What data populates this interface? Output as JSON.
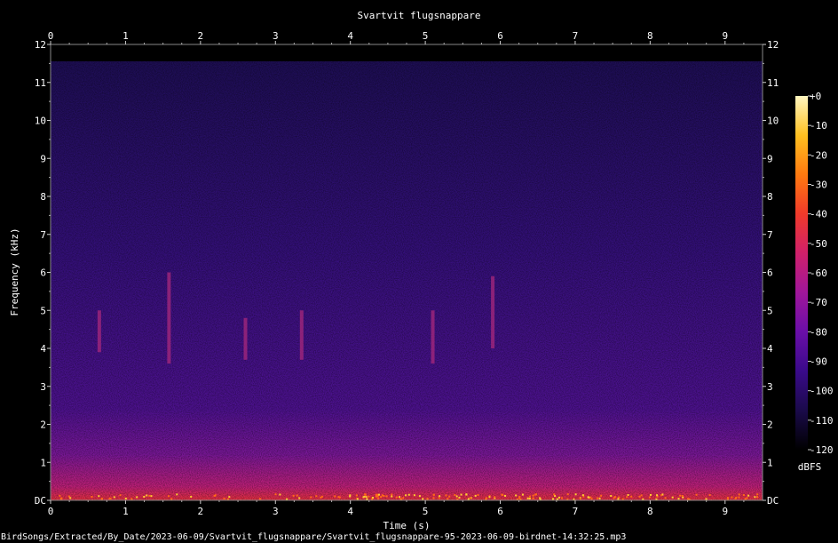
{
  "chart_data": {
    "type": "heatmap",
    "title": "Svartvit flugsnappare",
    "xlabel": "Time (s)",
    "ylabel": "Frequency (kHz)",
    "xlim": [
      0,
      9.5
    ],
    "ylim": [
      0,
      12
    ],
    "x_ticks": [
      "0",
      "1",
      "2",
      "3",
      "4",
      "5",
      "6",
      "7",
      "8",
      "9"
    ],
    "y_ticks": [
      "DC",
      "1",
      "2",
      "3",
      "4",
      "5",
      "6",
      "7",
      "8",
      "9",
      "10",
      "11",
      "12"
    ],
    "colorbar": {
      "label": "dBFS",
      "range": [
        -120,
        0
      ],
      "ticks": [
        "+0",
        "-10",
        "-20",
        "-30",
        "-40",
        "-50",
        "-60",
        "-70",
        "-80",
        "-90",
        "-100",
        "-110",
        "-120"
      ],
      "colors": [
        "#000000",
        "#1a0a4a",
        "#3a0a8a",
        "#6a0ea8",
        "#a0169a",
        "#d0206a",
        "#f03a2a",
        "#ff7a10",
        "#ffc020",
        "#fff6c0"
      ]
    },
    "background_level_dbfs": -95,
    "low_frequency_band": {
      "freq_khz": [
        0,
        1.2
      ],
      "level_dbfs": -72
    },
    "calls": [
      {
        "time_s": 0.65,
        "freq_khz": [
          3.9,
          5.0
        ]
      },
      {
        "time_s": 1.58,
        "freq_khz": [
          3.6,
          6.0
        ]
      },
      {
        "time_s": 2.6,
        "freq_khz": [
          3.7,
          4.8
        ]
      },
      {
        "time_s": 3.35,
        "freq_khz": [
          3.7,
          5.0
        ]
      },
      {
        "time_s": 5.1,
        "freq_khz": [
          3.6,
          5.0
        ]
      },
      {
        "time_s": 5.9,
        "freq_khz": [
          4.0,
          5.9
        ]
      }
    ],
    "grid": false
  },
  "footer": {
    "filepath": "BirdSongs/Extracted/By_Date/2023-06-09/Svartvit_flugsnappare/Svartvit_flugsnappare-95-2023-06-09-birdnet-14:32:25.mp3"
  }
}
